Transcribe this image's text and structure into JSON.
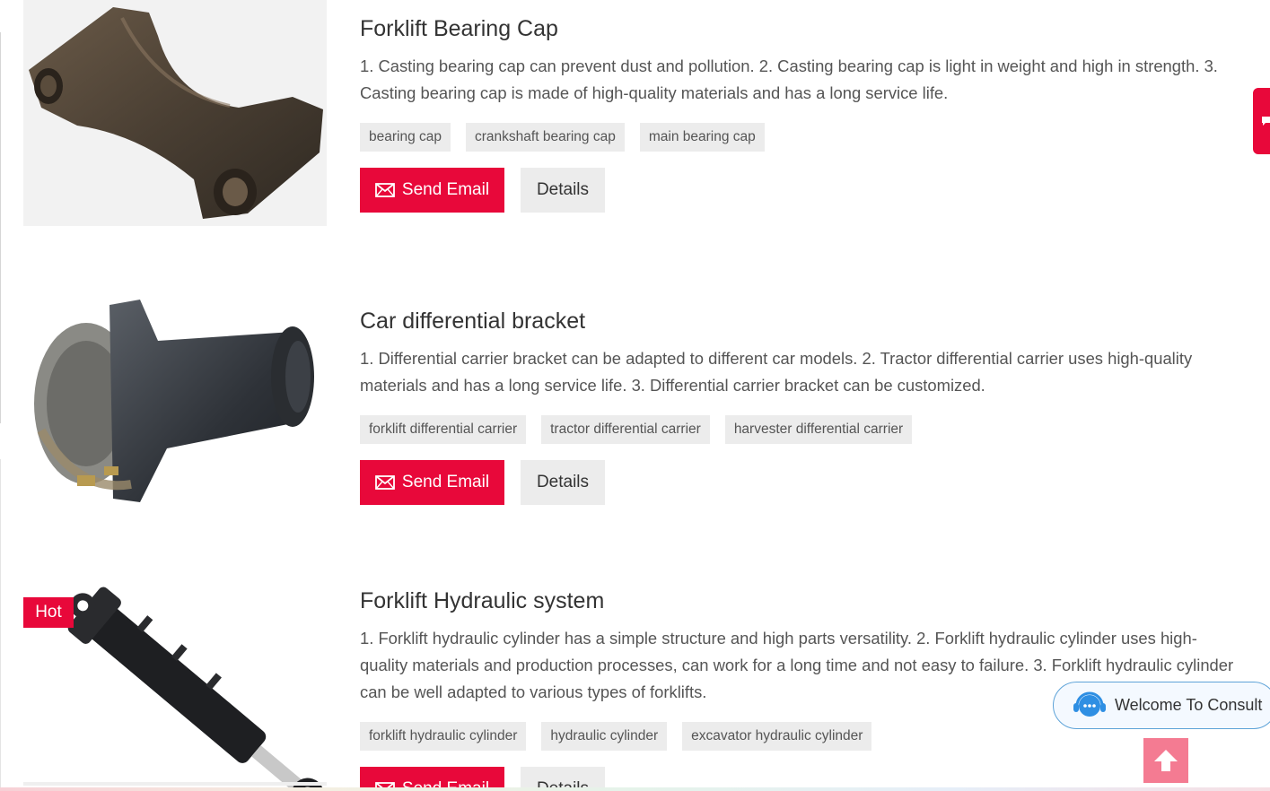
{
  "products": [
    {
      "image_alt": "forklift bearing cap photo",
      "title": "Forklift Bearing Cap",
      "description": "1. Casting bearing cap can prevent dust and pollution. 2. Casting bearing cap is light in weight and high in strength. 3. Casting bearing cap is made of high-quality materials and has a long service life.",
      "tags": [
        "bearing cap",
        "crankshaft bearing cap",
        "main bearing cap"
      ],
      "send_email_label": "Send Email",
      "details_label": "Details"
    },
    {
      "image_alt": "car differential bracket photo",
      "title": "Car differential bracket",
      "description": "1. Differential carrier bracket can be adapted to different car models. 2. Tractor differential carrier uses high-quality materials and has a long service life. 3. Differential carrier bracket can be customized.",
      "tags": [
        "forklift differential carrier",
        "tractor differential carrier",
        "harvester differential carrier"
      ],
      "send_email_label": "Send Email",
      "details_label": "Details"
    },
    {
      "image_alt": "forklift hydraulic cylinder photo",
      "badge": "Hot",
      "title": "Forklift Hydraulic system",
      "description": "1. Forklift hydraulic cylinder has a simple structure and high parts versatility. 2. Forklift hydraulic cylinder uses high-quality materials and production processes, can work for a long time and not easy to failure. 3. Forklift hydraulic cylinder can be well adapted to various types of forklifts.",
      "tags": [
        "forklift hydraulic cylinder",
        "hydraulic cylinder",
        "excavator hydraulic cylinder"
      ],
      "send_email_label": "Send Email",
      "details_label": "Details"
    }
  ],
  "consult": {
    "label": "Welcome To Consult",
    "icon": "headset-icon"
  },
  "back_to_top": {
    "icon": "arrow-up-icon"
  },
  "side_tab": {
    "icon": "chat-bubble-icon"
  },
  "icons": {
    "email": "envelope-icon"
  },
  "colors": {
    "accent": "#e8083a",
    "tag_bg": "#ececec",
    "back_to_top": "#f47b92",
    "consult_border": "#5ea3d8"
  }
}
